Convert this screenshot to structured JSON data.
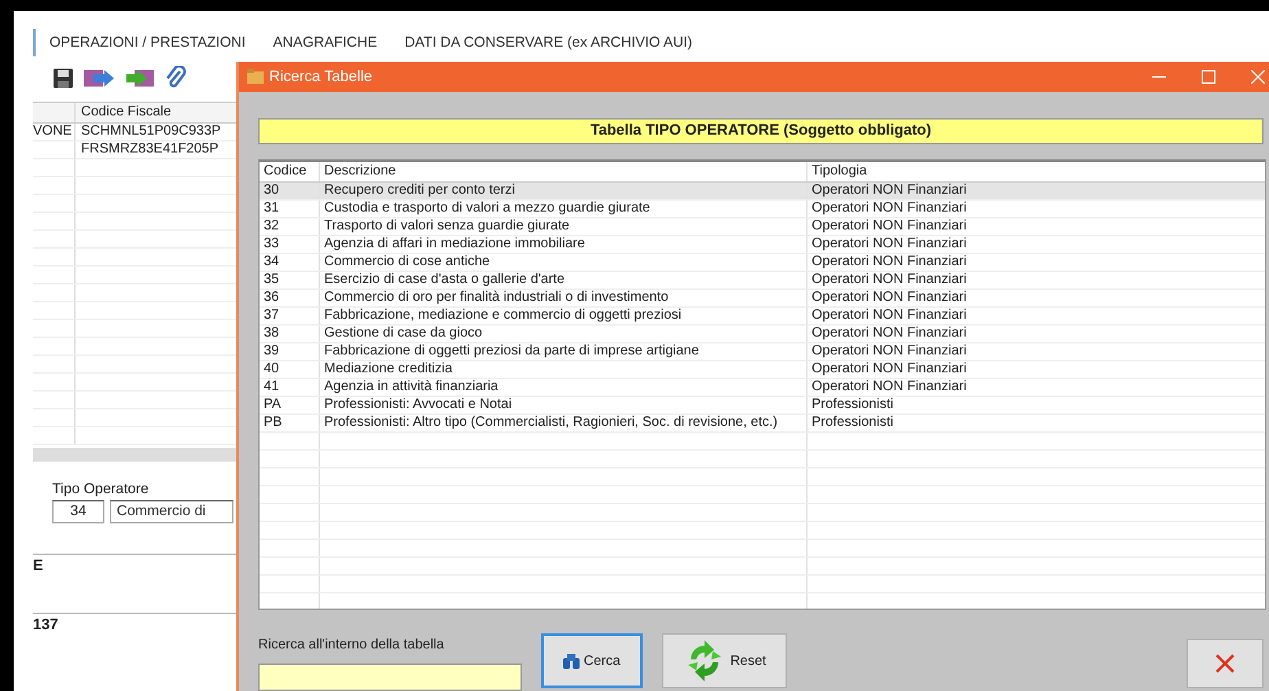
{
  "background": {
    "tabs": [
      {
        "label": "OPERAZIONI / PRESTAZIONI"
      },
      {
        "label": "ANAGRAFICHE"
      },
      {
        "label": "DATI DA CONSERVARE (ex ARCHIVIO AUI)"
      }
    ],
    "grid": {
      "columns": [
        "Codice Fiscale"
      ],
      "rows": [
        {
          "column_1": "VONE",
          "codice_fiscale": "SCHMNL51P09C933P"
        },
        {
          "codice_fiscale": "FRSMRZ83E41F205P"
        }
      ]
    },
    "tipo_operatore": {
      "label": "Tipo Operatore",
      "code": "34",
      "description": "Commercio di"
    },
    "fields": [
      "E",
      "137"
    ]
  },
  "dialog": {
    "title": "Ricerca Tabelle",
    "heading": "Tabella TIPO OPERATORE (Soggetto obbligato)",
    "table": {
      "columns": [
        "Codice",
        "Descrizione",
        "Tipologia"
      ],
      "rows": [
        {
          "codice": "30",
          "descrizione": "Recupero crediti per conto terzi",
          "tipologia": "Operatori NON Finanziari",
          "selected": true
        },
        {
          "codice": "31",
          "descrizione": "Custodia e trasporto di valori a mezzo guardie giurate",
          "tipologia": "Operatori NON Finanziari",
          "selected": false
        },
        {
          "codice": "32",
          "descrizione": "Trasporto di valori senza guardie giurate",
          "tipologia": "Operatori NON Finanziari",
          "selected": false
        },
        {
          "codice": "33",
          "descrizione": "Agenzia di affari in mediazione immobiliare",
          "tipologia": "Operatori NON Finanziari",
          "selected": false
        },
        {
          "codice": "34",
          "descrizione": "Commercio di cose antiche",
          "tipologia": "Operatori NON Finanziari",
          "selected": false
        },
        {
          "codice": "35",
          "descrizione": "Esercizio di case d'asta o gallerie d'arte",
          "tipologia": "Operatori NON Finanziari",
          "selected": false
        },
        {
          "codice": "36",
          "descrizione": "Commercio di oro per finalità industriali o di investimento",
          "tipologia": "Operatori NON Finanziari",
          "selected": false
        },
        {
          "codice": "37",
          "descrizione": "Fabbricazione, mediazione e commercio di oggetti preziosi",
          "tipologia": "Operatori NON Finanziari",
          "selected": false
        },
        {
          "codice": "38",
          "descrizione": "Gestione di case da gioco",
          "tipologia": "Operatori NON Finanziari",
          "selected": false
        },
        {
          "codice": "39",
          "descrizione": "Fabbricazione di oggetti preziosi da parte di imprese artigiane",
          "tipologia": "Operatori NON Finanziari",
          "selected": false
        },
        {
          "codice": "40",
          "descrizione": "Mediazione creditizia",
          "tipologia": "Operatori NON Finanziari",
          "selected": false
        },
        {
          "codice": "41",
          "descrizione": "Agenzia in attività finanziaria",
          "tipologia": "Operatori NON Finanziari",
          "selected": false
        },
        {
          "codice": "PA",
          "descrizione": "Professionisti: Avvocati e Notai",
          "tipologia": "Professionisti",
          "selected": false
        },
        {
          "codice": "PB",
          "descrizione": "Professionisti: Altro tipo (Commercialisti, Ragionieri, Soc. di revisione, etc.)",
          "tipologia": "Professionisti",
          "selected": false
        }
      ]
    },
    "search": {
      "label": "Ricerca all'interno della tabella"
    },
    "buttons": [
      {
        "label": "Cerca",
        "kind": "search",
        "focused": true
      },
      {
        "label": "Reset",
        "kind": "reset",
        "focused": false
      }
    ]
  }
}
